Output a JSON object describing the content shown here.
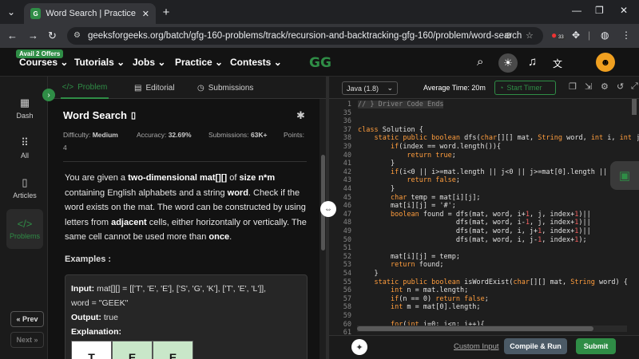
{
  "browser": {
    "tab_title": "Word Search | Practice | GeeksforG",
    "url": "geeksforgeeks.org/batch/gfg-160-problems/track/recursion-and-backtracking-gfg-160/problem/word-search",
    "ext_badge": "33"
  },
  "nav": {
    "offer_badge": "Avail 2 Offers",
    "items": [
      "Courses",
      "Tutorials",
      "Jobs",
      "Practice",
      "Contests"
    ],
    "logo_text": "GG"
  },
  "sidebar": {
    "items": [
      "Dash",
      "All",
      "Articles",
      "Problems"
    ],
    "prev": "Prev",
    "next": "Next"
  },
  "problem_tabs": [
    "Problem",
    "Editorial",
    "Submissions"
  ],
  "problem": {
    "title": "Word Search",
    "difficulty_label": "Difficulty:",
    "difficulty": "Medium",
    "accuracy_label": "Accuracy:",
    "accuracy": "32.69%",
    "submissions_label": "Submissions:",
    "submissions": "63K+",
    "points_label": "Points:",
    "points": "4",
    "desc": {
      "p1": "You are given a ",
      "b1": "two-dimensional mat[][]",
      "p2": " of ",
      "b2": "size n*m",
      "p3": " containing English alphabets and a string ",
      "b3": "word",
      "p4": ". Check if the word exists on the mat. The word can be constructed by using letters from ",
      "b4": "adjacent",
      "p5": " cells, either horizontally or vertically. The same cell cannot be used more than ",
      "b5": "once",
      "p6": "."
    },
    "examples_heading": "Examples :",
    "example": {
      "input_label": "Input:",
      "input_mat": "mat[][] = [['T', 'E', 'E'], ['S', 'G', 'K'], ['T', 'E', 'L']],",
      "input_word": "word = \"GEEK\"",
      "output_label": "Output:",
      "output": "true",
      "explanation_label": "Explanation:",
      "grid_row": [
        "T",
        "E",
        "E"
      ]
    }
  },
  "editor": {
    "language": "Java (1.8)",
    "avg_time": "Average Time: 20m",
    "timer_label": "Start Timer",
    "custom_input": "Custom Input",
    "compile": "Compile & Run",
    "submit": "Submit",
    "line_numbers": [
      "1",
      "35",
      "36",
      "37",
      "38",
      "39",
      "40",
      "41",
      "42",
      "43",
      "44",
      "45",
      "46",
      "47",
      "48",
      "49",
      "50",
      "51",
      "52",
      "53",
      "54",
      "55",
      "56",
      "57",
      "58",
      "59",
      "60",
      "61"
    ],
    "lines": [
      "// } Driver Code Ends",
      "",
      "",
      "class Solution {",
      "    static public boolean dfs(char[][] mat, String word, int i, int j, int index){",
      "        if(index == word.length()){",
      "            return true;",
      "        }",
      "        if(i<0 || i>=mat.length || j<0 || j>=mat[0].length || mat[i][j]!=word.charAt(index)){",
      "            return false;",
      "        }",
      "        char temp = mat[i][j];",
      "        mat[i][j] = '#';",
      "        boolean found = dfs(mat, word, i+1, j, index+1)||",
      "                        dfs(mat, word, i-1, j, index+1)||",
      "                        dfs(mat, word, i, j+1, index+1)||",
      "                        dfs(mat, word, i, j-1, index+1);",
      "",
      "        mat[i][j] = temp;",
      "        return found;",
      "    }",
      "    static public boolean isWordExist(char[][] mat, String word) {",
      "        int n = mat.length;",
      "        if(n == 0) return false;",
      "        int m = mat[0].length;",
      "",
      "        for(int i=0; i<n; i++){",
      ""
    ]
  },
  "colors": {
    "accent": "#2f8d46",
    "bg": "#121212",
    "keyword": "#ff9d3d",
    "number": "#f06060"
  }
}
